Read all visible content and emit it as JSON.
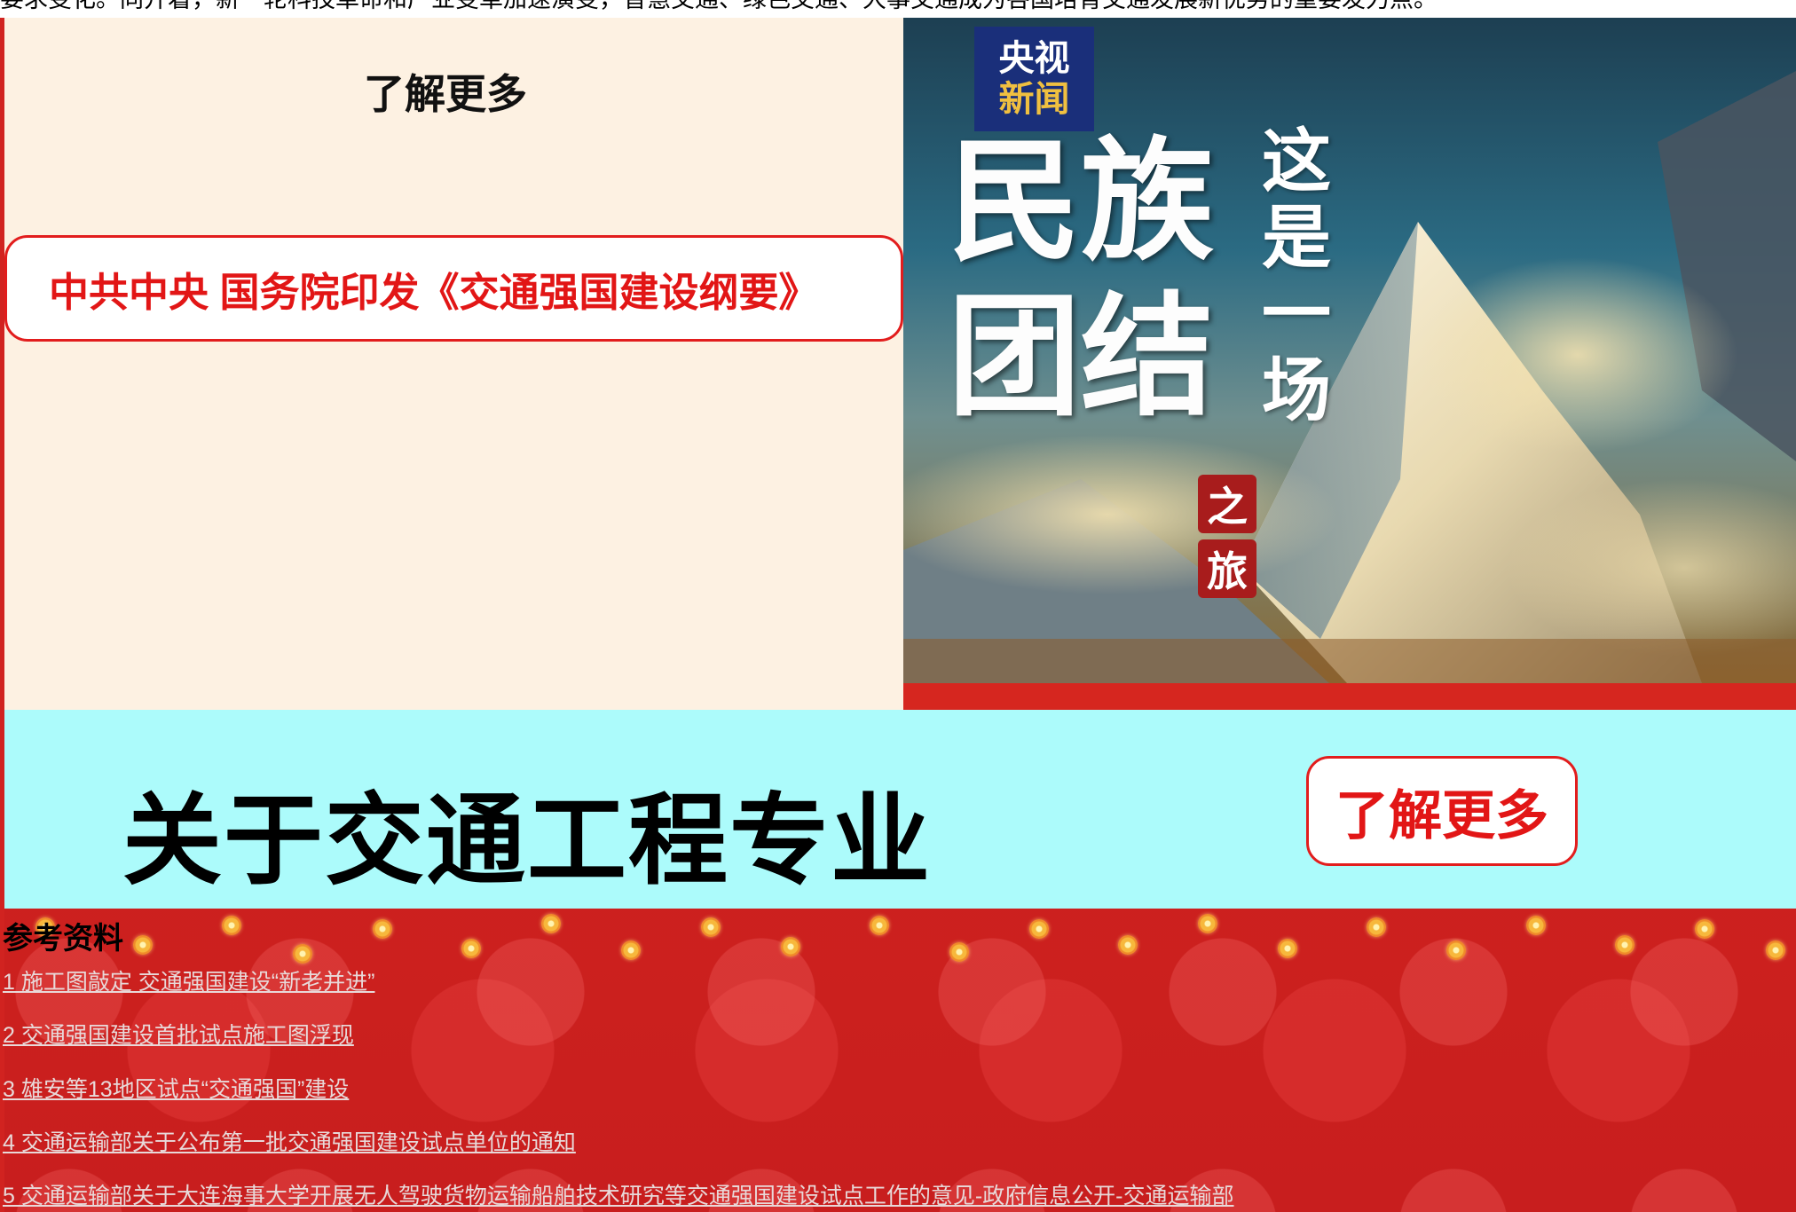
{
  "top_strip": {
    "text": "要求变化。同开着，新一轮科技革命和产业变革加速演变，智慧交通、绿色交通、大事交通成为各国培育交通发展新优势的重要发力点。"
  },
  "left_panel": {
    "learn_more": "了解更多",
    "doc_link": "中共中央 国务院印发《交通强国建设纲要》"
  },
  "video": {
    "logo_line1": "央视",
    "logo_line2": "新闻",
    "title_big": "民族团结",
    "title_vertical": "这是一场",
    "seal_top": "之",
    "seal_bottom": "旅"
  },
  "banner": {
    "title": "关于交通工程专业",
    "button_label": "了解更多"
  },
  "references": {
    "heading": "参考资料",
    "items": [
      "1 施工图敲定 交通强国建设“新老并进”",
      "2 交通强国建设首批试点施工图浮现",
      "3 雄安等13地区试点“交通强国”建设",
      "4 交通运输部关于公布第一批交通强国建设试点单位的通知",
      "5 交通运输部关于大连海事大学开展无人驾驶货物运输船舶技术研究等交通强国建设试点工作的意见-政府信息公开-交通运输部"
    ]
  }
}
